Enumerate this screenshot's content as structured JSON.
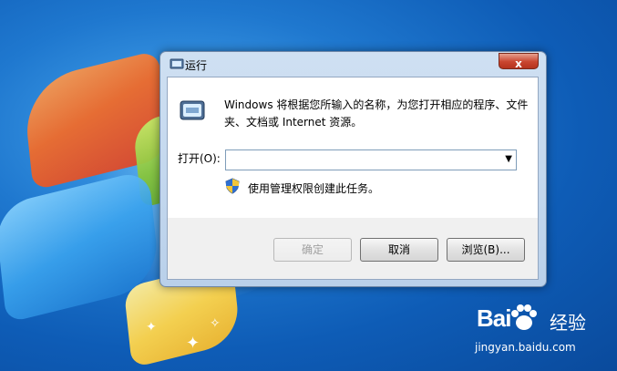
{
  "window": {
    "title": "运行",
    "close_symbol": "x",
    "description": "Windows 将根据您所输入的名称，为您打开相应的程序、文件夹、文档或 Internet 资源。",
    "open_label": "打开(O):",
    "open_value": "",
    "admin_note": "使用管理权限创建此任务。",
    "buttons": {
      "ok": "确定",
      "cancel": "取消",
      "browse": "浏览(B)..."
    }
  },
  "icons": {
    "app": "run-icon",
    "shield": "uac-shield-icon",
    "dropdown": "chevron-down-icon"
  },
  "watermark": {
    "logo": "Bai",
    "brand": "经验",
    "url": "jingyan.baidu.com"
  },
  "colors": {
    "desktop": "#1f78cf",
    "close_button": "#c9452f"
  }
}
